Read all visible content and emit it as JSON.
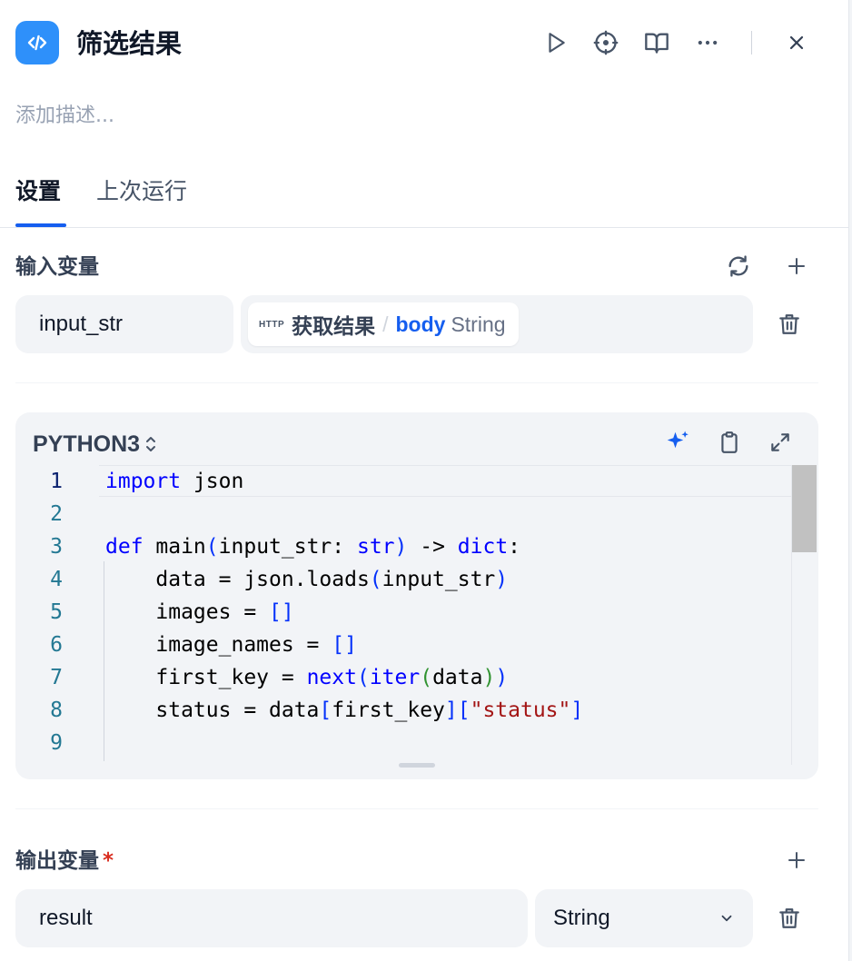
{
  "header": {
    "title": "筛选结果",
    "logo_icon": "code-icon",
    "accent": "#2e90fa"
  },
  "description_placeholder": "添加描述...",
  "tabs": [
    {
      "label": "设置",
      "active": true
    },
    {
      "label": "上次运行",
      "active": false
    }
  ],
  "input_vars": {
    "label": "输入变量",
    "items": [
      {
        "name": "input_str",
        "source_tag": "HTTP",
        "source_node": "获取结果",
        "separator": "/",
        "source_var": "body",
        "source_type": "String"
      }
    ]
  },
  "code": {
    "language": "PYTHON3",
    "line_numbers": [
      "1",
      "2",
      "3",
      "4",
      "5",
      "6",
      "7",
      "8",
      "9"
    ]
  },
  "output_vars": {
    "label": "输出变量",
    "required_mark": "*",
    "items": [
      {
        "name": "result",
        "type": "String"
      }
    ]
  }
}
